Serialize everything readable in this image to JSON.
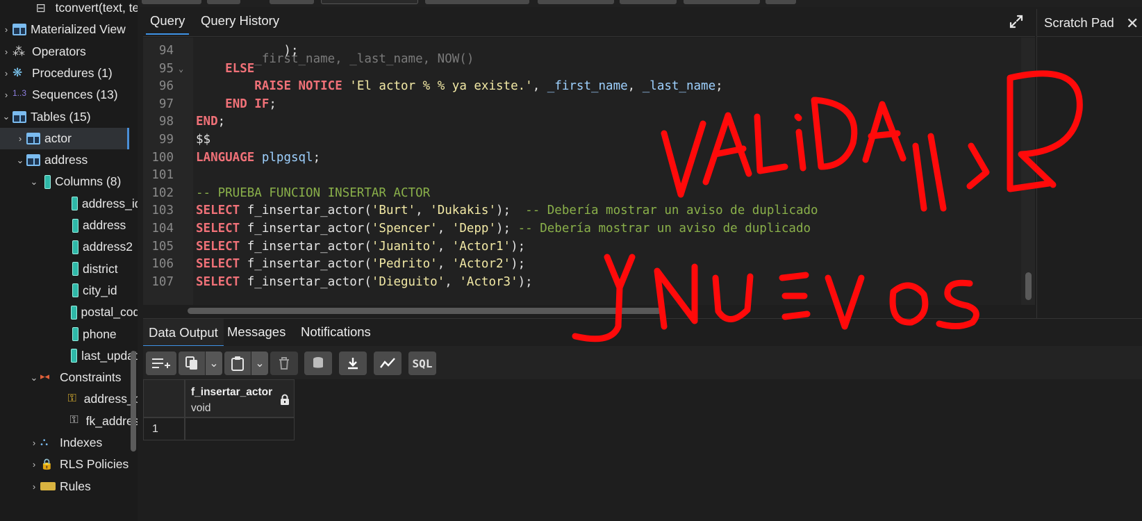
{
  "sidebar": {
    "items": [
      {
        "label": "tconvert(text, te",
        "icon": "function-icon",
        "arrow": ""
      },
      {
        "label": "Materialized View",
        "icon": "materialized-view-icon",
        "arrow": "›"
      },
      {
        "label": "Operators",
        "icon": "operators-icon",
        "arrow": "›"
      },
      {
        "label": "Procedures (1)",
        "icon": "procedures-icon",
        "arrow": "›"
      },
      {
        "label": "Sequences (13)",
        "icon": "sequences-icon",
        "arrow": "›"
      },
      {
        "label": "Tables (15)",
        "icon": "tables-icon",
        "arrow": "⌄"
      },
      {
        "label": "actor",
        "icon": "table-icon",
        "arrow": "›"
      },
      {
        "label": "address",
        "icon": "table-icon",
        "arrow": "⌄"
      },
      {
        "label": "Columns (8)",
        "icon": "columns-icon",
        "arrow": "⌄"
      },
      {
        "label": "address_id",
        "icon": "column-icon",
        "arrow": ""
      },
      {
        "label": "address",
        "icon": "column-icon",
        "arrow": ""
      },
      {
        "label": "address2",
        "icon": "column-icon",
        "arrow": ""
      },
      {
        "label": "district",
        "icon": "column-icon",
        "arrow": ""
      },
      {
        "label": "city_id",
        "icon": "column-icon",
        "arrow": ""
      },
      {
        "label": "postal_code",
        "icon": "column-icon",
        "arrow": ""
      },
      {
        "label": "phone",
        "icon": "column-icon",
        "arrow": ""
      },
      {
        "label": "last_update",
        "icon": "column-icon",
        "arrow": ""
      },
      {
        "label": "Constraints",
        "icon": "constraints-icon",
        "arrow": "⌄"
      },
      {
        "label": "address_pkey",
        "icon": "primary-key-icon",
        "arrow": ""
      },
      {
        "label": "fk_address",
        "icon": "foreign-key-icon",
        "arrow": ""
      },
      {
        "label": "Indexes",
        "icon": "indexes-icon",
        "arrow": "›"
      },
      {
        "label": "RLS Policies",
        "icon": "rls-policies-icon",
        "arrow": "›"
      },
      {
        "label": "Rules",
        "icon": "rules-icon",
        "arrow": "›"
      }
    ]
  },
  "query": {
    "tabs": [
      "Query",
      "Query History"
    ],
    "lines": [
      {
        "n": "94",
        "fold": "",
        "html": "            );"
      },
      {
        "n": "95",
        "fold": "⌄",
        "html": "    <span class=\"kw\">ELSE</span>"
      },
      {
        "n": "96",
        "fold": "",
        "html": "        <span class=\"kw\">RAISE NOTICE</span> <span class=\"str\">'El actor % % ya existe.'</span>, <span class=\"id\">_first_name</span>, <span class=\"id\">_last_name</span>;"
      },
      {
        "n": "97",
        "fold": "",
        "html": "    <span class=\"kw\">END IF</span>;"
      },
      {
        "n": "98",
        "fold": "",
        "html": "<span class=\"kw\">END</span>;"
      },
      {
        "n": "99",
        "fold": "",
        "html": "$$"
      },
      {
        "n": "100",
        "fold": "",
        "html": "<span class=\"kw\">LANGUAGE</span> <span class=\"id\">plpgsql</span>;"
      },
      {
        "n": "101",
        "fold": "",
        "html": ""
      },
      {
        "n": "102",
        "fold": "",
        "html": "<span class=\"cm\">-- PRUEBA FUNCION INSERTAR ACTOR</span>"
      },
      {
        "n": "103",
        "fold": "",
        "html": "<span class=\"kw\">SELECT</span> f_insertar_actor(<span class=\"str\">'Burt'</span>, <span class=\"str\">'Dukakis'</span>);  <span class=\"cm\">-- Debería mostrar un aviso de duplicado</span>"
      },
      {
        "n": "104",
        "fold": "",
        "html": "<span class=\"kw\">SELECT</span> f_insertar_actor(<span class=\"str\">'Spencer'</span>, <span class=\"str\">'Depp'</span>); <span class=\"cm\">-- Debería mostrar un aviso de duplicado</span>"
      },
      {
        "n": "105",
        "fold": "",
        "html": "<span class=\"kw\">SELECT</span> f_insertar_actor(<span class=\"str\">'Juanito'</span>, <span class=\"str\">'Actor1'</span>);"
      },
      {
        "n": "106",
        "fold": "",
        "html": "<span class=\"kw\">SELECT</span> f_insertar_actor(<span class=\"str\">'Pedrito'</span>, <span class=\"str\">'Actor2'</span>);"
      },
      {
        "n": "107",
        "fold": "",
        "html": "<span class=\"kw\">SELECT</span> f_insertar_actor(<span class=\"str\">'Dieguito'</span>, <span class=\"str\">'Actor3'</span>);"
      }
    ]
  },
  "scratch_pad": {
    "title": "Scratch Pad"
  },
  "output": {
    "tabs": [
      "Data Output",
      "Messages",
      "Notifications"
    ],
    "toolbar": {
      "sql_label": "SQL"
    },
    "grid": {
      "column_name": "f_insertar_actor",
      "column_type": "void",
      "rows": [
        "1"
      ]
    }
  },
  "handwriting": {
    "line1": "VALIDAR",
    "line2": "y NUEVOS"
  },
  "colors": {
    "accent": "#3e92e6",
    "ink": "#ff0a0a",
    "keyword": "#f07178",
    "string": "#f2e9a5",
    "comment": "#8ab04a"
  }
}
